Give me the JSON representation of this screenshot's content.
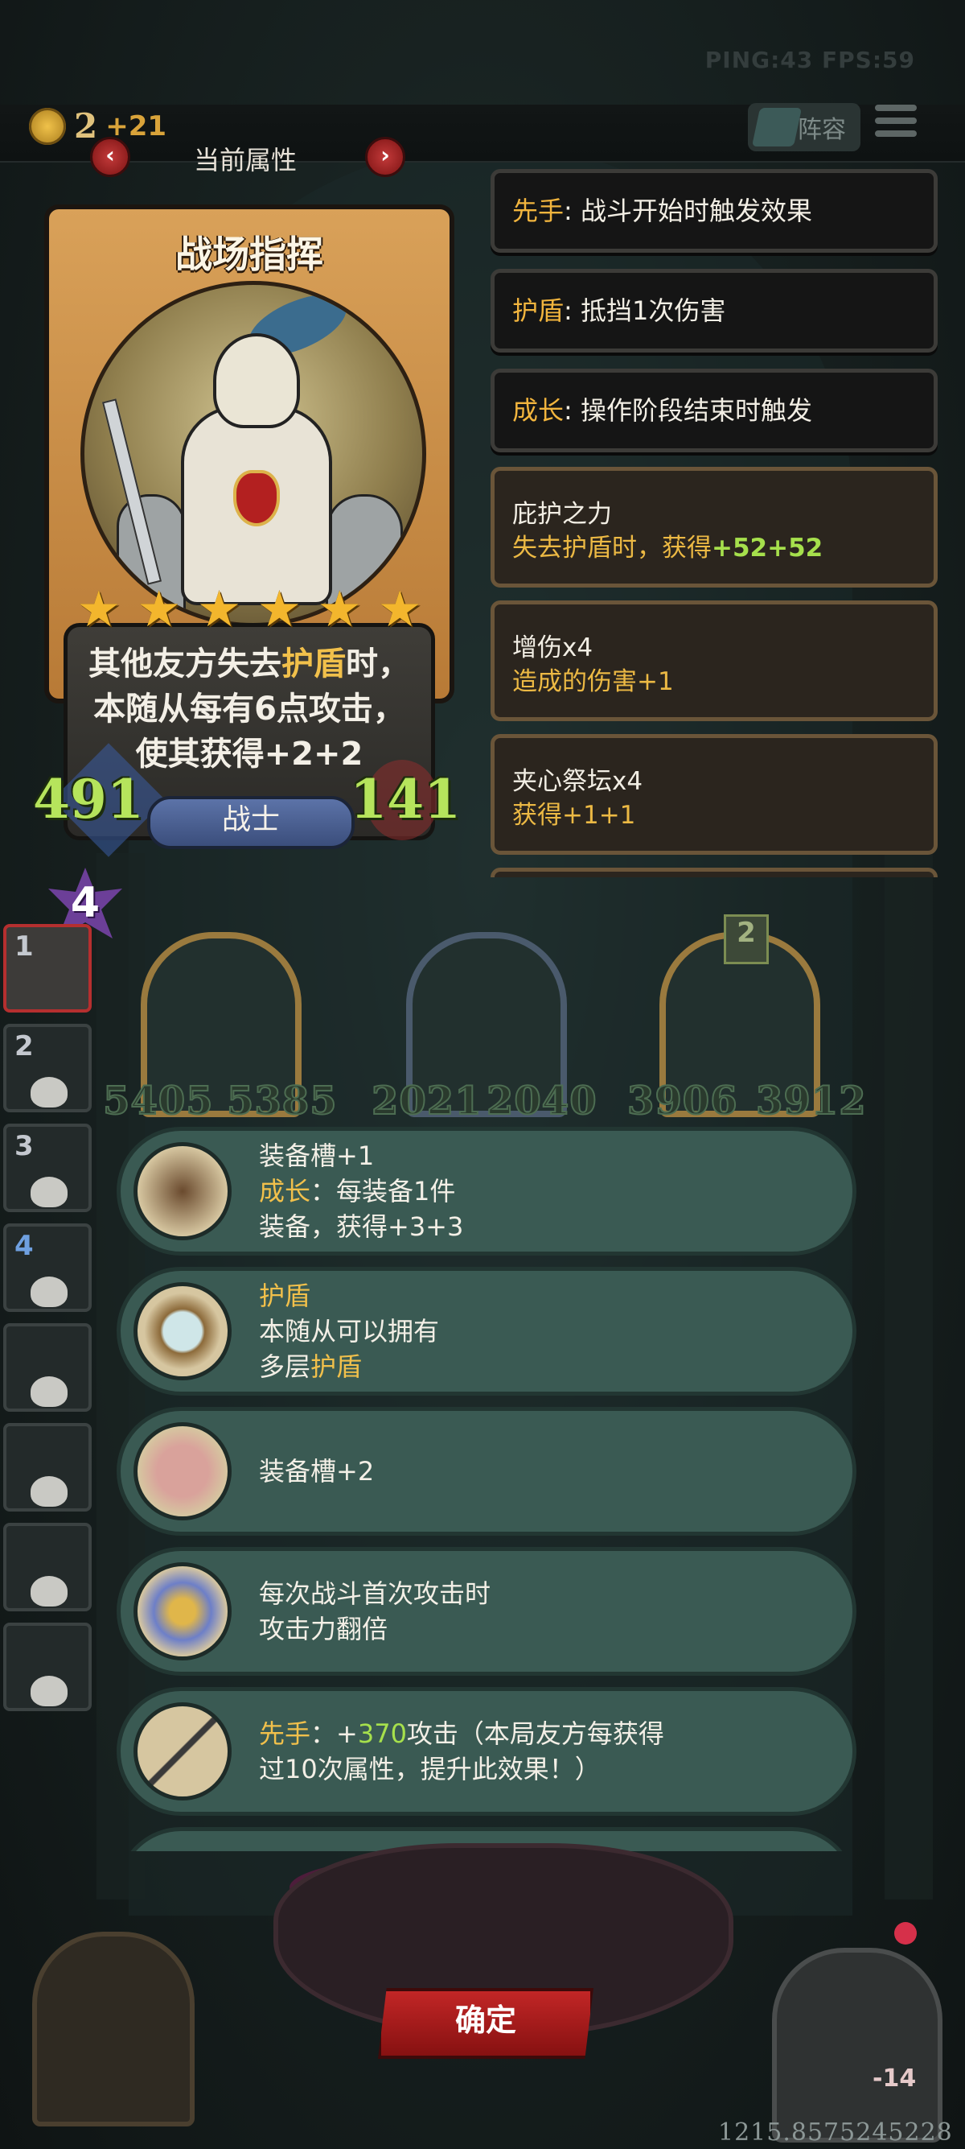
{
  "status": {
    "text": "PING:43   FPS:59"
  },
  "gold": {
    "amount": "2",
    "delta": "+21"
  },
  "topbar": {
    "lineup_label": "阵容"
  },
  "panel": {
    "title": "当前属性",
    "prev": "‹",
    "next": "›"
  },
  "hero": {
    "name": "战场指挥",
    "stars": [
      "★",
      "★",
      "★",
      "★",
      "★",
      "★"
    ],
    "desc_1": "其他友方失去",
    "desc_hl": "护盾",
    "desc_2": "时，本随从每有6点攻击，使其获得+2+2",
    "attack": "491",
    "health": "141",
    "class": "战士"
  },
  "keywords": [
    {
      "label": "先手",
      "text": ": 战斗开始时触发效果"
    },
    {
      "label": "护盾",
      "text": ": 抵挡1次伤害"
    },
    {
      "label": "成长",
      "text": ": 操作阶段结束时触发"
    }
  ],
  "buffs": [
    {
      "name": "庇护之力",
      "effect": "失去护盾时，获得",
      "value": "+52+52"
    },
    {
      "name": "增伤x4",
      "effect": "造成的伤害+1",
      "value": ""
    },
    {
      "name": "夹心祭坛x4",
      "effect": "获得+1+1",
      "value": ""
    }
  ],
  "level": "4",
  "bench": [
    "1",
    "2",
    "3",
    "4",
    "",
    "",
    "",
    ""
  ],
  "arena": {
    "unit_num": "2",
    "stats": [
      "5405",
      "5385",
      "2021",
      "2040",
      "3906",
      "3912"
    ]
  },
  "items": [
    {
      "icon": "armor-icon",
      "lines": [
        [
          {
            "t": "装备槽+1",
            "c": ""
          }
        ],
        [
          {
            "t": "成长",
            "c": "yel"
          },
          {
            "t": "：每装备1件",
            "c": ""
          }
        ],
        [
          {
            "t": "装备，获得+3+3",
            "c": ""
          }
        ]
      ]
    },
    {
      "icon": "mirror-icon",
      "lines": [
        [
          {
            "t": "护盾",
            "c": "yel"
          }
        ],
        [
          {
            "t": "本随从可以拥有",
            "c": ""
          }
        ],
        [
          {
            "t": "多层",
            "c": ""
          },
          {
            "t": "护盾",
            "c": "yel"
          }
        ]
      ]
    },
    {
      "icon": "pig-armor-icon",
      "lines": [
        [
          {
            "t": "装备槽+2",
            "c": ""
          }
        ]
      ]
    },
    {
      "icon": "magic-charm-icon",
      "lines": [
        [
          {
            "t": "每次战斗首次攻击时",
            "c": ""
          }
        ],
        [
          {
            "t": "攻击力翻倍",
            "c": ""
          }
        ]
      ]
    },
    {
      "icon": "spear-icon",
      "lines": [
        [
          {
            "t": "先手",
            "c": "yel"
          },
          {
            "t": "：+",
            "c": ""
          },
          {
            "t": "370",
            "c": "grn"
          },
          {
            "t": "攻击（本局友方每获得",
            "c": ""
          }
        ],
        [
          {
            "t": "过10次属性，提升此效果！）",
            "c": ""
          }
        ]
      ]
    }
  ],
  "confirm_label": "确定",
  "opponent": {
    "hp": "-14"
  },
  "coords": "1215.8575245228"
}
